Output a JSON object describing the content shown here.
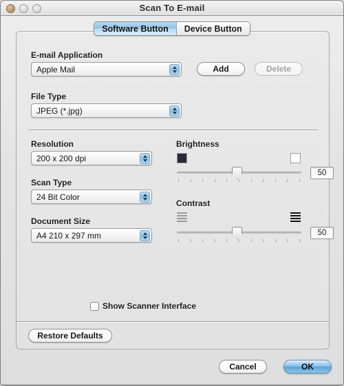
{
  "window": {
    "title": "Scan To E-mail",
    "traffic_lights": [
      "close-button",
      "minimize-button",
      "zoom-button"
    ]
  },
  "tabs": [
    {
      "label": "Software Button",
      "active": true
    },
    {
      "label": "Device Button",
      "active": false
    }
  ],
  "form": {
    "email_application": {
      "label": "E-mail Application",
      "value": "Apple Mail",
      "add_label": "Add",
      "delete_label": "Delete",
      "delete_disabled": true
    },
    "file_type": {
      "label": "File Type",
      "value": "JPEG (*.jpg)"
    },
    "resolution": {
      "label": "Resolution",
      "value": "200 x 200 dpi"
    },
    "scan_type": {
      "label": "Scan Type",
      "value": "24 Bit Color"
    },
    "document_size": {
      "label": "Document Size",
      "value": "A4  210 x 297 mm"
    },
    "brightness": {
      "label": "Brightness",
      "value": "50",
      "min_icon": "dark-square-icon",
      "max_icon": "light-square-icon",
      "thumb_percent": 50,
      "tick_count": 11
    },
    "contrast": {
      "label": "Contrast",
      "value": "50",
      "min_icon": "low-contrast-stripes-icon",
      "max_icon": "high-contrast-stripes-icon",
      "thumb_percent": 50,
      "tick_count": 11
    },
    "show_scanner_interface": {
      "label": "Show Scanner Interface",
      "checked": false
    },
    "restore_defaults_label": "Restore Defaults"
  },
  "footer": {
    "cancel_label": "Cancel",
    "ok_label": "OK"
  },
  "colors": {
    "accent": "#8cc2e9",
    "window_bg": "#e4e4e4",
    "panel_bg": "#e6e6e6",
    "text": "#1c1c1c"
  }
}
